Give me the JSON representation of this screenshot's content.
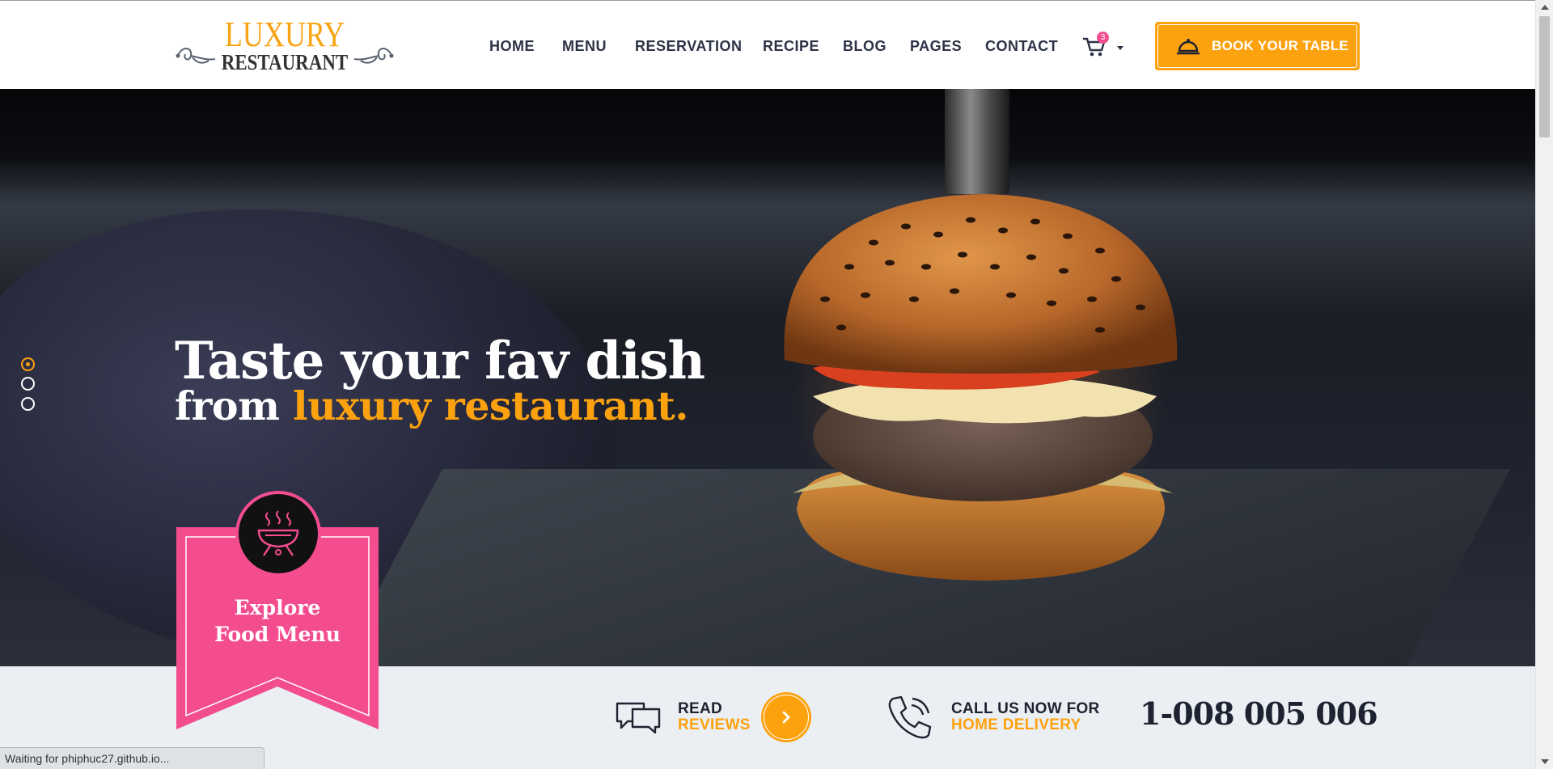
{
  "brand": {
    "logo_top": "LUXURY",
    "logo_bottom": "RESTAURANT",
    "accent_color": "#fda20f",
    "pink_color": "#f34d8f",
    "dark_color": "#1d2331"
  },
  "nav": {
    "items": [
      "HOME",
      "MENU",
      "RESERVATION",
      "RECIPE",
      "BLOG",
      "PAGES",
      "CONTACT"
    ],
    "cart_icon": "shopping-cart-icon",
    "cart_count": "3",
    "book_button": "BOOK YOUR TABLE",
    "book_icon": "serving-dish-icon"
  },
  "hero": {
    "line1": "Taste your fav dish",
    "line2_prefix": "from ",
    "line2_highlight": "luxury restaurant.",
    "active_slide": 1,
    "slide_count": 3
  },
  "ribbon": {
    "icon": "grill-icon",
    "line1": "Explore",
    "line2": "Food Menu"
  },
  "info": {
    "reviews_line1": "READ",
    "reviews_line2": "REVIEWS",
    "reviews_icon": "chat-bubbles-icon",
    "delivery_line1": "CALL US NOW FOR",
    "delivery_line2": "HOME DELIVERY",
    "delivery_icon": "phone-icon",
    "phone": "1-008 005 006"
  },
  "browser": {
    "status_text": "Waiting for phiphuc27.github.io..."
  }
}
